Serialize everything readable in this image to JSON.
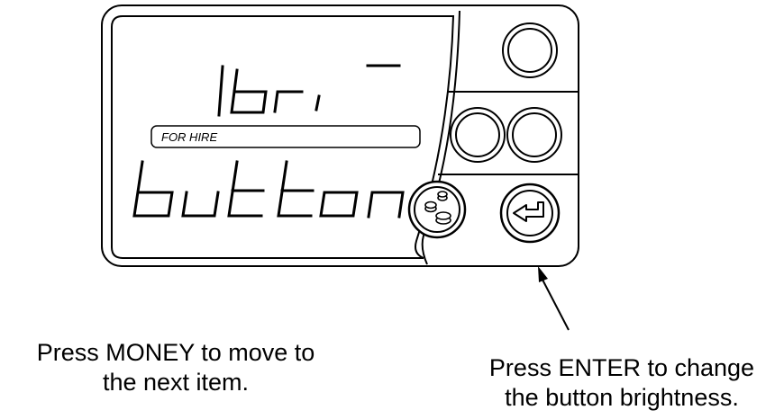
{
  "display": {
    "top_readout": "bri",
    "status_label": "FOR HIRE",
    "main_readout": "button"
  },
  "buttons": [
    {
      "name": "top-right-button",
      "icon": "blank"
    },
    {
      "name": "middle-left-button",
      "icon": "blank"
    },
    {
      "name": "middle-right-button",
      "icon": "blank"
    },
    {
      "name": "money-button",
      "icon": "money-icon"
    },
    {
      "name": "enter-button",
      "icon": "enter-arrow-icon"
    }
  ],
  "captions": {
    "left": [
      "Press MONEY to move to",
      "the next item."
    ],
    "right": [
      "Press ENTER to change",
      "the button brightness."
    ]
  }
}
